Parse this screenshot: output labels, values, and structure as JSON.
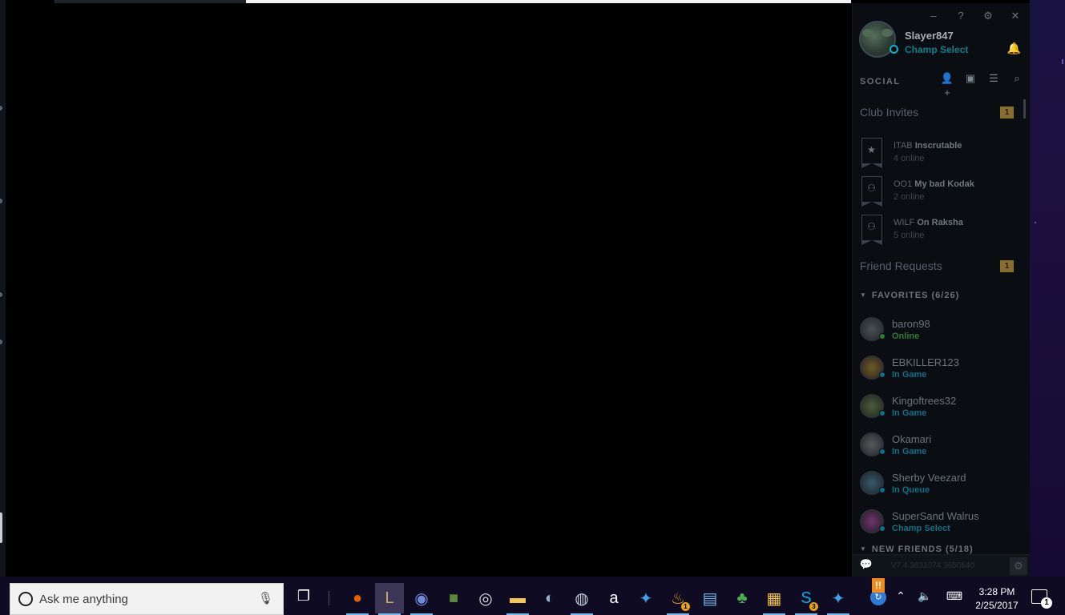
{
  "window_controls": {
    "minimize": "–",
    "help": "?",
    "settings": "⚙",
    "close": "✕"
  },
  "profile": {
    "name": "Slayer847",
    "status": "Champ Select",
    "status_color": "#0e7d8e"
  },
  "social": {
    "title": "SOCIAL",
    "tools": [
      "add-friend-icon",
      "add-folder-icon",
      "list-icon",
      "search-icon"
    ]
  },
  "club_invites": {
    "label": "Club Invites",
    "count": "1",
    "clubs": [
      {
        "tag": "ITAB",
        "name": "Inscrutable",
        "online": "4 online",
        "icon": "star-icon"
      },
      {
        "tag": "OO1",
        "name": "My bad Kodak",
        "online": "2 online",
        "icon": "group-icon"
      },
      {
        "tag": "WILF",
        "name": "On Raksha",
        "online": "5 online",
        "icon": "group-icon"
      }
    ]
  },
  "friend_requests": {
    "label": "Friend Requests",
    "count": "1"
  },
  "favorites": {
    "label": "FAVORITES (6/26)",
    "friends": [
      {
        "name": "baron98",
        "status": "Online",
        "status_color": "#2a7a3a"
      },
      {
        "name": "EBKILLER123",
        "status": "In Game",
        "status_color": "#0c6f86"
      },
      {
        "name": "Kingoftrees32",
        "status": "In Game",
        "status_color": "#0c6f86"
      },
      {
        "name": "Okamari",
        "status": "In Game",
        "status_color": "#0c6f86"
      },
      {
        "name": "Sherby Veezard",
        "status": "In Queue",
        "status_color": "#0c6f86"
      },
      {
        "name": "SuperSand Walrus",
        "status": "Champ Select",
        "status_color": "#0c6f86"
      }
    ]
  },
  "new_friends": {
    "label": "NEW FRIENDS (5/18)"
  },
  "footer": {
    "version": "V7.4.3631074 3650540"
  },
  "taskbar": {
    "search_placeholder": "Ask me anything",
    "apps": [
      {
        "name": "firefox-icon",
        "glyph": "●",
        "color": "#e66000"
      },
      {
        "name": "league-client-icon",
        "glyph": "L",
        "color": "#c8aa6e",
        "active": true
      },
      {
        "name": "discord-icon",
        "glyph": "◉",
        "color": "#7289da"
      },
      {
        "name": "minecraft-icon",
        "glyph": "■",
        "color": "#5d8a36"
      },
      {
        "name": "overwatch-icon",
        "glyph": "◎",
        "color": "#dddddd"
      },
      {
        "name": "file-explorer-icon",
        "glyph": "▬",
        "color": "#f2c94c"
      },
      {
        "name": "teamspeak-icon",
        "glyph": "◐",
        "color": "#8fb3d9"
      },
      {
        "name": "steam-icon",
        "glyph": "◍",
        "color": "#c5d0dc"
      },
      {
        "name": "amazon-icon",
        "glyph": "a",
        "color": "#ffffff"
      },
      {
        "name": "battlenet-icon",
        "glyph": "✦",
        "color": "#3ea0e8"
      },
      {
        "name": "app-notification-icon",
        "glyph": "♨",
        "color": "#e8a317",
        "badge": "1"
      },
      {
        "name": "id-card-icon",
        "glyph": "▤",
        "color": "#6fb6e8"
      },
      {
        "name": "tree-icon",
        "glyph": "♣",
        "color": "#4caf50"
      },
      {
        "name": "file-sync-icon",
        "glyph": "▦",
        "color": "#f2c94c"
      },
      {
        "name": "skype-icon",
        "glyph": "S",
        "color": "#00aff0",
        "badge": "3"
      },
      {
        "name": "battlenet-2-icon",
        "glyph": "✦",
        "color": "#3ea0e8"
      }
    ],
    "clock_time": "3:28 PM",
    "clock_date": "2/25/2017",
    "notification_count": "1"
  }
}
